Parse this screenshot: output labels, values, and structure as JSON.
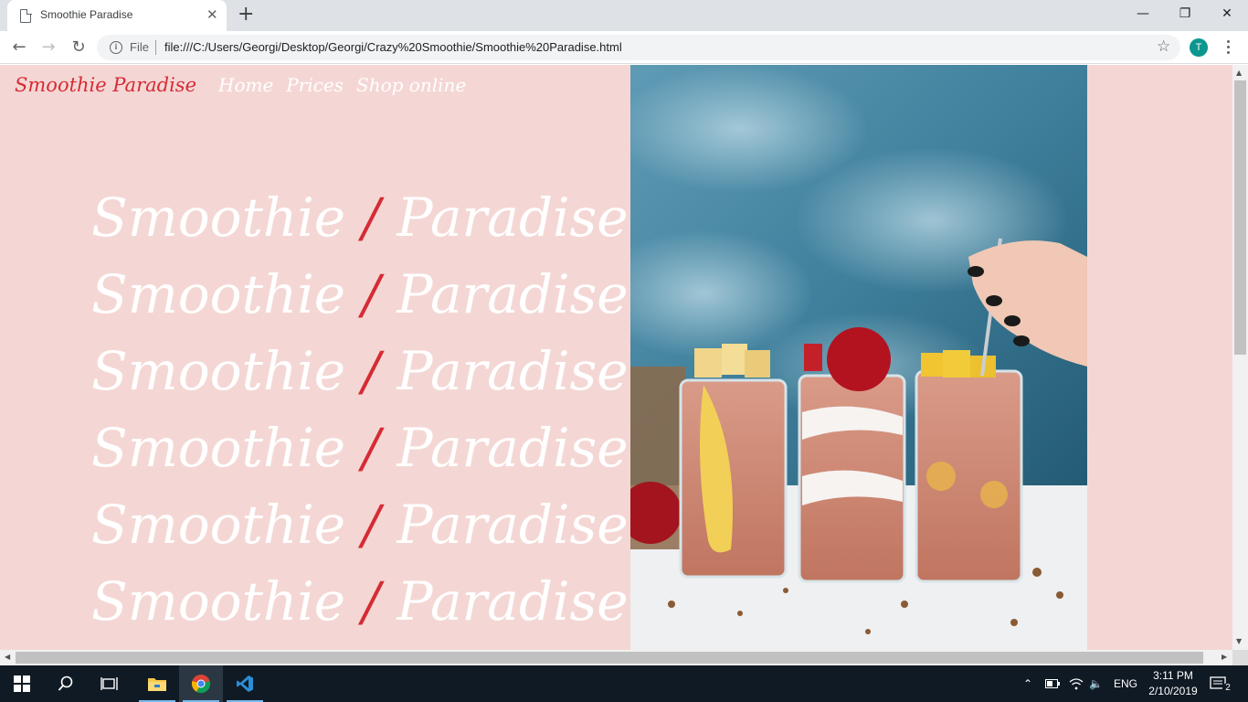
{
  "browser": {
    "tab_title": "Smoothie Paradise",
    "new_tab_icon": "plus-icon",
    "url_scheme": "File",
    "url": "file:///C:/Users/Georgi/Desktop/Georgi/Crazy%20Smoothie/Smoothie%20Paradise.html",
    "avatar_letter": "T"
  },
  "page": {
    "brand": "Smoothie Paradise",
    "nav": [
      "Home",
      "Prices",
      "Shop online"
    ],
    "hero_word_1": "Smoothie",
    "hero_slash": "/",
    "hero_word_2": "Paradise",
    "hero_repeat_count": 6,
    "colors": {
      "background": "#f4d7d4",
      "accent": "#d62b35",
      "text": "#ffffff"
    }
  },
  "taskbar": {
    "language": "ENG",
    "time": "3:11 PM",
    "date": "2/10/2019",
    "notification_count": "2"
  }
}
